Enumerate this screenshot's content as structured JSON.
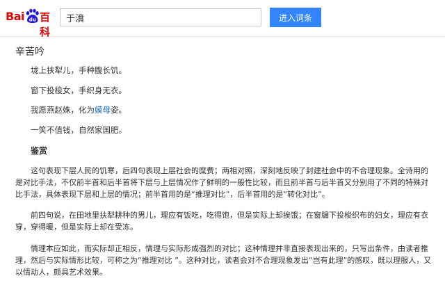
{
  "header": {
    "logo_bai": "Bai",
    "logo_du": "du",
    "logo_baike": "百科",
    "search_value": "于濆",
    "search_button": "进入词条"
  },
  "poem": {
    "title": "辛苦吟",
    "lines": [
      "垅上扶犁儿，手种腹长饥。",
      "窗下投梭女，手织身无衣。",
      "一笑不值钱，自然家国肥。"
    ],
    "line3_pre": "我愿燕赵姝，化为",
    "line3_link": "嫫母",
    "line3_post": "姿。"
  },
  "appreciation": {
    "heading": "鉴赏",
    "paragraphs": [
      "这句表现下层人民的饥寒，后四句表现上层社会的糜费；两相对照，深刻地反映了封建社会中的不合理现象。全诗用的是对比手法，不仅前半首和后半首将下层与上层情况作了鲜明的一般性比较，而且前半首与后半首又分别用了不同的特殊对比手法，具体表现下层和上层的情况；前半首用的是“推理对比”，后半首用的是“转化对比”。",
      "前四句说，在田地里扶犁耕种的男儿，理应有饭吃，吃得饱，但是实际上却挨饿；在窗牖下投梭织布的妇女，理应有衣穿，穿得暖，但是实际上却在受冻。",
      "情理本应如此，而实际却正相反，情理与实际形成强烈的对比；这种情理并非直接表现出来的，只写出条件，由读者推理，然后与实际情形比较，可称之为“推理对比 ”。这种对比，读者会对不合理现象发出“岂有此理”的感叹，既以理服人，又以情动人，颇具艺术效果。"
    ]
  },
  "colors": {
    "brand_red": "#e10602",
    "brand_blue": "#2319dc",
    "button_blue": "#3385ff",
    "link_blue": "#136ec2"
  }
}
